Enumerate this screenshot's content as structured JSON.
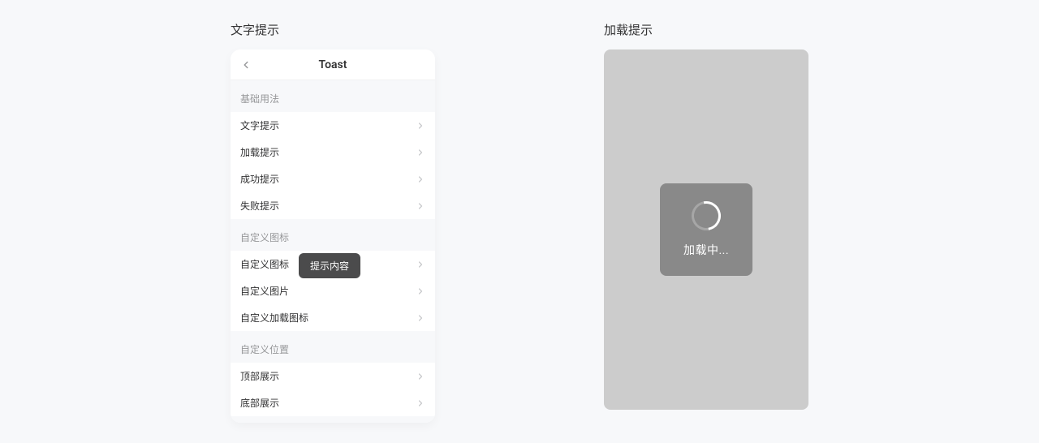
{
  "left": {
    "sectionTitle": "文字提示",
    "navTitle": "Toast",
    "groups": {
      "basic": {
        "label": "基础用法",
        "items": [
          "文字提示",
          "加载提示",
          "成功提示",
          "失败提示"
        ]
      },
      "customIcon": {
        "label": "自定义图标",
        "items": [
          "自定义图标",
          "自定义图片",
          "自定义加载图标"
        ]
      },
      "customPosition": {
        "label": "自定义位置",
        "items": [
          "顶部展示",
          "底部展示"
        ]
      }
    },
    "toastText": "提示内容"
  },
  "right": {
    "sectionTitle": "加载提示",
    "loadingText": "加载中..."
  }
}
